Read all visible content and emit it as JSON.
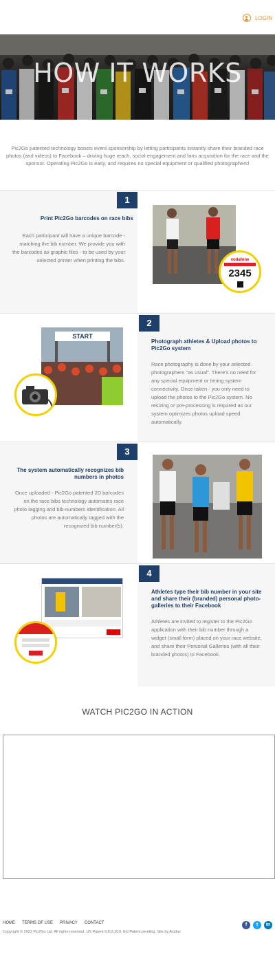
{
  "header": {
    "login_label": "LOGIN"
  },
  "hero": {
    "title": "HOW IT WORKS"
  },
  "intro": {
    "text": "Pic2Go patented technology boosts event sponsorship by letting participants instantly share their branded race photos (and videos) to Facebook  – driving huge reach, social engagement and fans acquisition for the race and the sponsor. Operating Pic2Go is easy, and requires no special equipment or qualified photographers!"
  },
  "steps": [
    {
      "number": "1",
      "title": "Print Pic2Go barcodes on race bibs",
      "text": "Each participant will have a unique barcode - matching the bib number. We provide you with the barcodes as graphic files - to be used by your selected printer when printing the bibs.",
      "bib_number": "2345",
      "bib_brand": "vodafone"
    },
    {
      "number": "2",
      "title": "Photograph athletes & Upload photos to Pic2Go system",
      "text": "Race photography is done by your selected photographers \"as usual\". There's no need for any special equipment or timing system connectivity. Once taken - you only need to upload the photos to the Pic2Go system. No resizing or pre-processing is required as our system optimizes photos upload speed automatically.",
      "banner": "START"
    },
    {
      "number": "3",
      "title": "The system automatically recognizes bib numbers in photos",
      "text": "Once uploaded - Pic2Go patented 2D barcodes on the race bibs technology automates race photo tagging and bib-numbers identification. All photos are automatically tagged with the recognized bib number(s)."
    },
    {
      "number": "4",
      "title": "Athletes type their bib number in your site and share their (branded) personal photo-galleries to their Facebook",
      "text": "Athletes are invited to register to the Pic2Go application with their bib number through a widget (small form) placed on your race website, and share their Personal Galleries (with all their branded photos) to Facebook."
    }
  ],
  "watch": {
    "title": "WATCH PIC2GO IN ACTION"
  },
  "footer": {
    "links": [
      "HOME",
      "TERMS OF USE",
      "PRIVACY",
      "CONTACT"
    ],
    "copyright": "Copyright © 2022 Pic2Go Ltd. All rights reserved. US Patent 9,811,919. EU Patent pending.        Site by Acidoz",
    "social": [
      "facebook-icon",
      "twitter-icon",
      "linkedin-icon"
    ]
  },
  "colors": {
    "accent": "#e8912e",
    "navy": "#1f3f6b",
    "highlight": "#f5d000"
  }
}
